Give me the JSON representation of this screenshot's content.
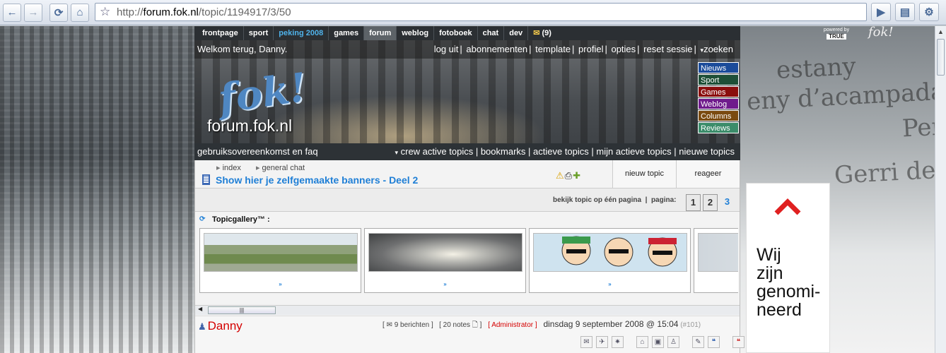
{
  "browser": {
    "url_scheme": "http://",
    "url_host": "forum.fok.nl",
    "url_path": "/topic/1194917/3/50"
  },
  "sitenav": {
    "items": [
      "frontpage",
      "sport",
      "peking 2008",
      "games",
      "forum",
      "weblog",
      "fotoboek",
      "chat",
      "dev"
    ],
    "mail_count": "(9)",
    "powered_by": "powered by",
    "powered_brand": "TRUE",
    "logo_small": "fok!"
  },
  "header": {
    "welcome": "Welkom terug, Danny.",
    "links": [
      "log uit",
      "abonnementen",
      "template",
      "profiel",
      "opties",
      "reset sessie",
      "zoeken"
    ],
    "logo": "fok!",
    "site_name": "forum.fok.nl",
    "side_tabs": [
      {
        "label": "Nieuws",
        "color": "#1b4b9a"
      },
      {
        "label": "Sport",
        "color": "#1e4f37"
      },
      {
        "label": "Games",
        "color": "#8a0e0e"
      },
      {
        "label": "Weblog",
        "color": "#6f1b8c"
      },
      {
        "label": "Columns",
        "color": "#7a4a10"
      },
      {
        "label": "Reviews",
        "color": "#3b8c6a"
      }
    ]
  },
  "subnav": {
    "left": "gebruiksovereenkomst en faq",
    "right": [
      "crew active topics",
      "bookmarks",
      "actieve topics",
      "mijn actieve topics",
      "nieuwe topics"
    ]
  },
  "topic": {
    "breadcrumbs": [
      "index",
      "general chat"
    ],
    "title": "Show hier je zelfgemaakte banners - Deel 2",
    "new_topic": "nieuw topic",
    "reply": "reageer",
    "view_one_page": "bekijk topic op één pagina",
    "page_label": "pagina:",
    "pages": [
      "1",
      "2",
      "3"
    ],
    "current_page": "3"
  },
  "gallery": {
    "title": "Topicgallery™ :",
    "more_label": "»",
    "thumbs": [
      "landscape-banner",
      "sky-banner",
      "southpark-banner",
      "fok-banner"
    ]
  },
  "post": {
    "author": "Danny",
    "messages": "[ ✉ 9 berichten ]",
    "notes": "[ 20 notes ",
    "notes_end": " ]",
    "role": "[ Administrator ]",
    "date": "dinsdag 9 september 2008 @ 15:04",
    "number": "(#101)"
  },
  "ad": {
    "text": "Wij zijn genomi-neerd"
  },
  "background_words": [
    "estany",
    "eny d’acampada",
    "Per",
    "Gerri de"
  ]
}
